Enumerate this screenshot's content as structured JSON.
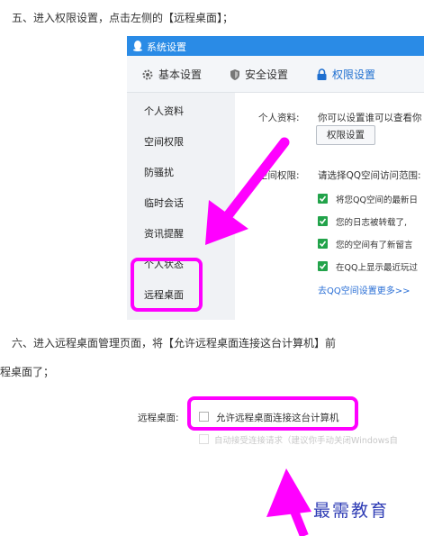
{
  "instructions": {
    "step5": "五、进入权限设置，点击左侧的【远程桌面】；",
    "step6_line1": "六、进入远程桌面管理页面，将【允许远程桌面连接这台计算机】前",
    "step6_line2": "程桌面了；"
  },
  "window": {
    "title": "系统设置",
    "toolbar": [
      {
        "label": "基本设置",
        "icon": "gear-icon"
      },
      {
        "label": "安全设置",
        "icon": "shield-icon"
      },
      {
        "label": "权限设置",
        "icon": "lock-icon",
        "active": true
      }
    ],
    "sidebar": [
      {
        "label": "个人资料"
      },
      {
        "label": "空间权限"
      },
      {
        "label": "防骚扰"
      },
      {
        "label": "临时会话"
      },
      {
        "label": "资讯提醒"
      },
      {
        "label": "个人状态"
      },
      {
        "label": "远程桌面",
        "highlighted": true
      }
    ],
    "profile": {
      "label": "个人资料:",
      "text": "你可以设置谁可以查看你",
      "button": "权限设置"
    },
    "space": {
      "label": "空间权限:",
      "text": "请选择QQ空间访问范围:"
    },
    "permissions": [
      "将您QQ空间的最新日",
      "您的日志被转载了,",
      "您的空间有了新留言",
      "在QQ上显示最近玩过"
    ],
    "more_link": "去QQ空间设置更多>>"
  },
  "remote": {
    "label": "远程桌面:",
    "allow_option": "允许远程桌面连接这台计算机",
    "auto_accept": "自动接受连接请求（建议你手动关闭Windows自"
  },
  "watermark": "最需教育",
  "colors": {
    "highlight": "#ff00ff",
    "titlebar": "#2a8be6",
    "check": "#22a34a",
    "link": "#2a6fd6"
  }
}
